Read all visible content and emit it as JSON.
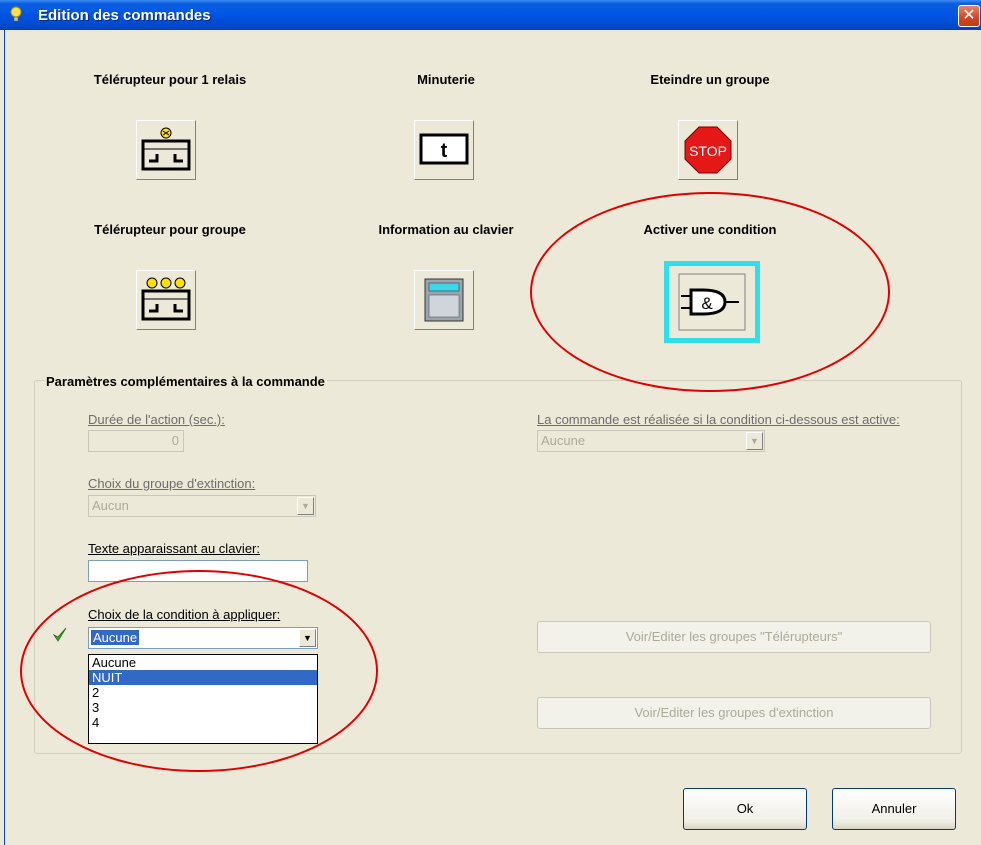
{
  "window": {
    "title": "Edition des commandes",
    "close_glyph": "✕"
  },
  "commands": [
    {
      "label": "Télérupteur pour 1 relais",
      "icon": "single-relay-icon"
    },
    {
      "label": "Minuterie",
      "icon": "timer-icon",
      "icon_text": "t"
    },
    {
      "label": "Eteindre un groupe",
      "icon": "stop-icon",
      "icon_text": "STOP"
    },
    {
      "label": "Télérupteur pour groupe",
      "icon": "group-relay-icon"
    },
    {
      "label": "Information au clavier",
      "icon": "keypad-icon"
    },
    {
      "label": "Activer une condition",
      "icon": "and-gate-icon",
      "icon_text": "&",
      "selected": true
    }
  ],
  "params": {
    "group_title": "Paramètres complémentaires à la commande",
    "duration_label": "Durée de l'action (sec.):",
    "duration_value": "0",
    "extinction_group_label": "Choix du groupe d'extinction:",
    "extinction_group_value": "Aucun",
    "keypad_text_label": "Texte apparaissant au clavier:",
    "keypad_text_value": "",
    "condition_label": "Choix de la condition à appliquer:",
    "condition_value": "Aucune",
    "condition_options": [
      "Aucune",
      "NUIT",
      "2",
      "3",
      "4"
    ],
    "condition_highlighted": "NUIT",
    "active_condition_label": "La commande est réalisée si la condition ci-dessous est active:",
    "active_condition_value": "Aucune"
  },
  "buttons": {
    "edit_relay_groups": "Voir/Editer les groupes \"Télérupteurs\"",
    "edit_extinction_groups": "Voir/Editer les groupes d'extinction",
    "ok": "Ok",
    "cancel": "Annuler"
  },
  "colors": {
    "titlebar": "#0055e5",
    "annotation": "#e00000",
    "selection_border": "#2fe0ec",
    "highlight": "#316ac5"
  }
}
